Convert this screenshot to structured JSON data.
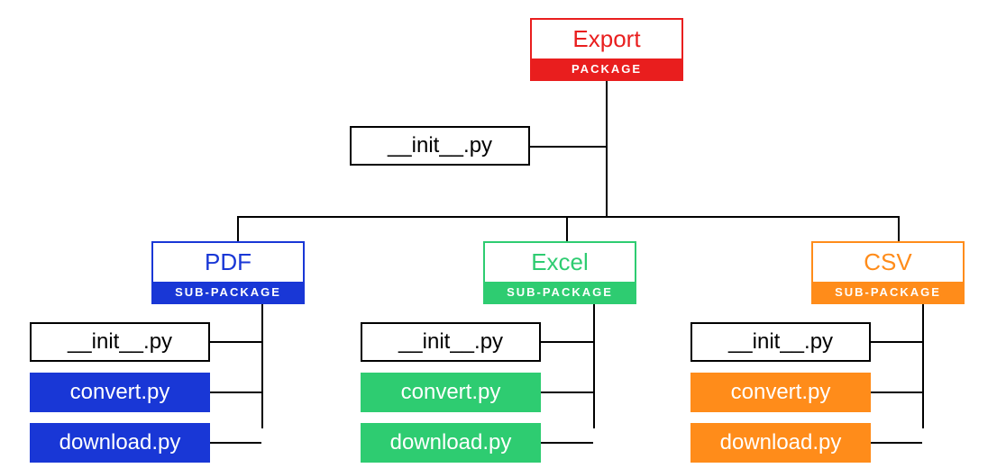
{
  "root": {
    "title": "Export",
    "label": "PACKAGE",
    "init_file": "__init__.py",
    "color": "#e91e1e",
    "border": "#e91e1e"
  },
  "subpackages": [
    {
      "key": "pdf",
      "title": "PDF",
      "label": "SUB-PACKAGE",
      "title_color": "#1937d6",
      "fill_color": "#1937d6",
      "border_color": "#1937d6",
      "files": [
        {
          "name": "__init__.py",
          "solid": false
        },
        {
          "name": "convert.py",
          "solid": true
        },
        {
          "name": "download.py",
          "solid": true
        }
      ]
    },
    {
      "key": "excel",
      "title": "Excel",
      "label": "SUB-PACKAGE",
      "title_color": "#2ecc71",
      "fill_color": "#2ecc71",
      "border_color": "#2ecc71",
      "files": [
        {
          "name": "__init__.py",
          "solid": false
        },
        {
          "name": "convert.py",
          "solid": true
        },
        {
          "name": "download.py",
          "solid": true
        }
      ]
    },
    {
      "key": "csv",
      "title": "CSV",
      "label": "SUB-PACKAGE",
      "title_color": "#ff8c1a",
      "fill_color": "#ff8c1a",
      "border_color": "#ff8c1a",
      "files": [
        {
          "name": "__init__.py",
          "solid": false
        },
        {
          "name": "convert.py",
          "solid": true
        },
        {
          "name": "download.py",
          "solid": true
        }
      ]
    }
  ]
}
